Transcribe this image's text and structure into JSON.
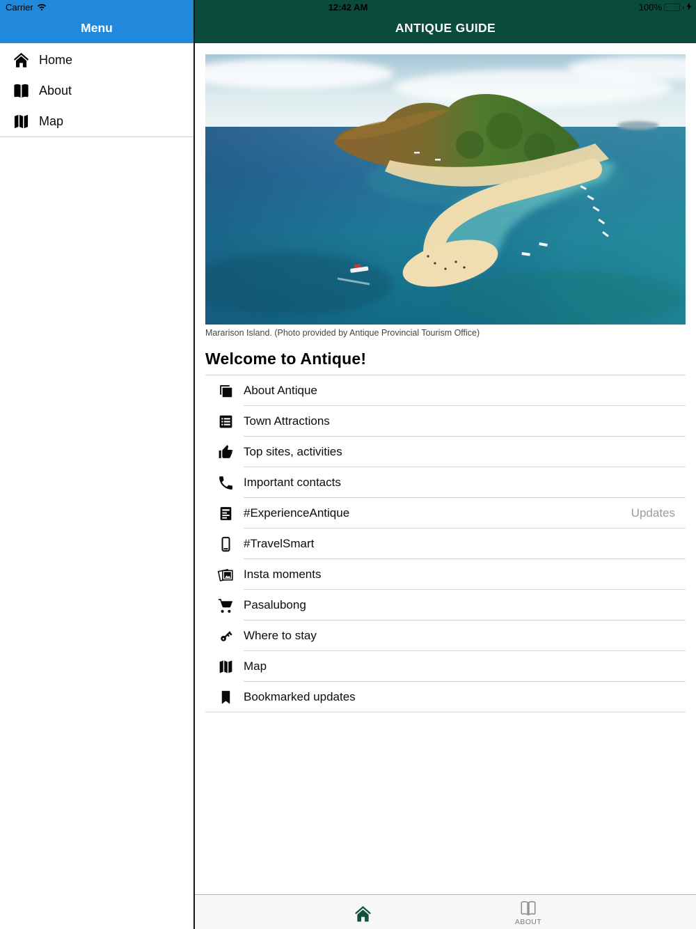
{
  "status_bar": {
    "carrier": "Carrier",
    "time": "12:42 AM",
    "battery_percent": "100%"
  },
  "sidebar": {
    "title": "Menu",
    "items": [
      {
        "label": "Home",
        "icon": "home-icon"
      },
      {
        "label": "About",
        "icon": "book-icon"
      },
      {
        "label": "Map",
        "icon": "map-icon"
      }
    ]
  },
  "header": {
    "title": "ANTIQUE GUIDE"
  },
  "main": {
    "photo": {
      "alt": "Aerial view of Mararison Island with curving white sandbar in turquoise sea"
    },
    "photo_caption": "Mararison Island. (Photo provided by Antique Provincial Tourism Office)",
    "heading": "Welcome to Antique!",
    "list": [
      {
        "label": "About Antique",
        "icon": "images-icon",
        "right": ""
      },
      {
        "label": "Town Attractions",
        "icon": "list-icon",
        "right": ""
      },
      {
        "label": "Top sites, activities",
        "icon": "thumbs-up-icon",
        "right": ""
      },
      {
        "label": "Important contacts",
        "icon": "phone-icon",
        "right": ""
      },
      {
        "label": "#ExperienceAntique",
        "icon": "news-icon",
        "right": "Updates"
      },
      {
        "label": "#TravelSmart",
        "icon": "smartphone-icon",
        "right": ""
      },
      {
        "label": "Insta moments",
        "icon": "photos-icon",
        "right": ""
      },
      {
        "label": "Pasalubong",
        "icon": "cart-icon",
        "right": ""
      },
      {
        "label": "Where to stay",
        "icon": "key-icon",
        "right": ""
      },
      {
        "label": "Map",
        "icon": "map-icon",
        "right": ""
      },
      {
        "label": "Bookmarked updates",
        "icon": "bookmark-icon",
        "right": ""
      }
    ]
  },
  "tab_bar": {
    "tabs": [
      {
        "label": "",
        "icon": "home-icon",
        "active": true
      },
      {
        "label": "ABOUT",
        "icon": "book-icon",
        "active": false
      }
    ]
  },
  "colors": {
    "header_green": "#0b4b3c",
    "menu_blue": "#2189dc",
    "battery_green": "#53d769",
    "divider": "#d4d4d4",
    "updates_gray": "#9b9b9b"
  }
}
